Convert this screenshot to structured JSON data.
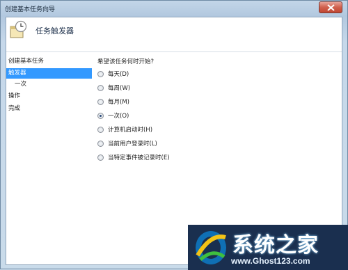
{
  "window": {
    "title": "创建基本任务向导",
    "close_icon": "close-icon"
  },
  "header": {
    "title": "任务触发器",
    "icon": "clock-task-icon"
  },
  "nav": {
    "items": [
      {
        "label": "创建基本任务",
        "selected": false,
        "sub": false
      },
      {
        "label": "触发器",
        "selected": true,
        "sub": false
      },
      {
        "label": "一次",
        "selected": false,
        "sub": true
      },
      {
        "label": "操作",
        "selected": false,
        "sub": false
      },
      {
        "label": "完成",
        "selected": false,
        "sub": false
      }
    ]
  },
  "trigger": {
    "question": "希望该任务何时开始?",
    "selected": "一次(O)",
    "options": [
      {
        "label": "每天(D)"
      },
      {
        "label": "每周(W)"
      },
      {
        "label": "每月(M)"
      },
      {
        "label": "一次(O)"
      },
      {
        "label": "计算机启动时(H)"
      },
      {
        "label": "当前用户登录时(L)"
      },
      {
        "label": "当特定事件被记录时(E)"
      }
    ]
  },
  "watermark": {
    "title": "系统之家",
    "url": "www.Ghost123.com"
  },
  "colors": {
    "selection": "#3399ff",
    "close_button": "#d0604d",
    "watermark_bg": "#1a2f4f"
  }
}
